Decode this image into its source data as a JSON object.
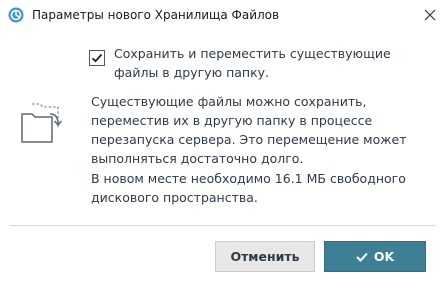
{
  "window": {
    "title": "Параметры нового Хранилища Файлов",
    "icon": "app-logo-icon",
    "close_icon": "close-icon"
  },
  "option": {
    "checked": true,
    "label": "Сохранить и переместить существующие файлы в другую папку."
  },
  "info": {
    "icon": "folder-move-icon",
    "description": "Существующие файлы можно сохранить, переместив их в другую папку в процессе перезапуска сервера. Это перемещение может выполняться достаточно долго.",
    "space_note": "В новом месте необходимо 16.1 МБ свободного дискового пространства."
  },
  "buttons": {
    "cancel_label": "Отменить",
    "ok_label": "OK"
  },
  "colors": {
    "ok_button": "#3d7f95",
    "cancel_button": "#e8e8e8",
    "text": "#2f3a48"
  }
}
